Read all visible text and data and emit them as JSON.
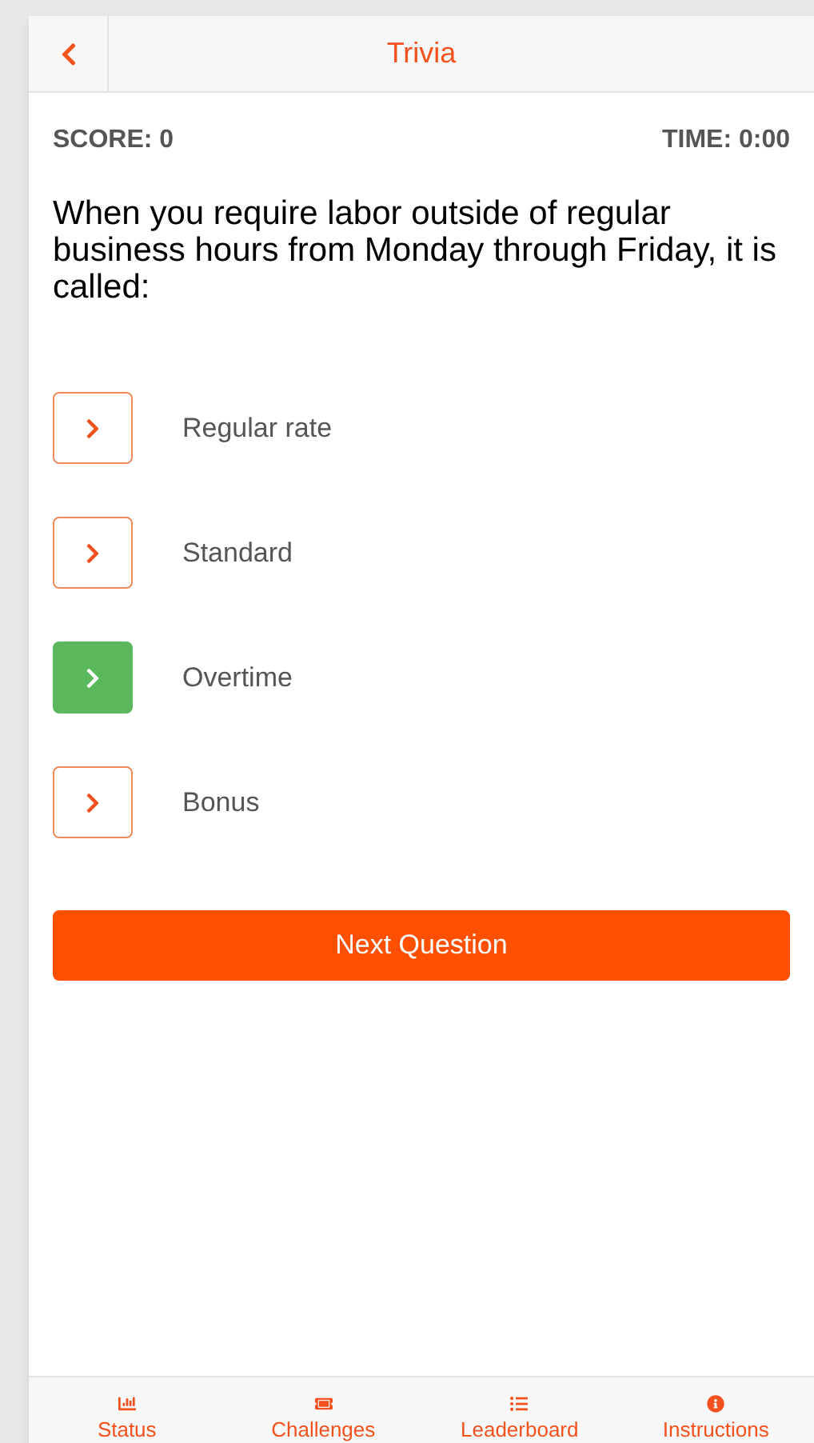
{
  "header": {
    "title": "Trivia"
  },
  "score": "SCORE: 0",
  "time": "TIME: 0:00",
  "question": "When you require labor outside of regular business hours from Monday through Friday, it is called:",
  "answers": [
    {
      "label": "Regular rate",
      "selected": false
    },
    {
      "label": "Standard",
      "selected": false
    },
    {
      "label": "Overtime",
      "selected": true
    },
    {
      "label": "Bonus",
      "selected": false
    }
  ],
  "next_button": "Next Question",
  "tab_bar": [
    {
      "kind": "status",
      "label": "Status"
    },
    {
      "kind": "challenges",
      "label": "Challenges"
    },
    {
      "kind": "leaderboard",
      "label": "Leaderboard"
    },
    {
      "kind": "instructions",
      "label": "Instructions"
    }
  ]
}
